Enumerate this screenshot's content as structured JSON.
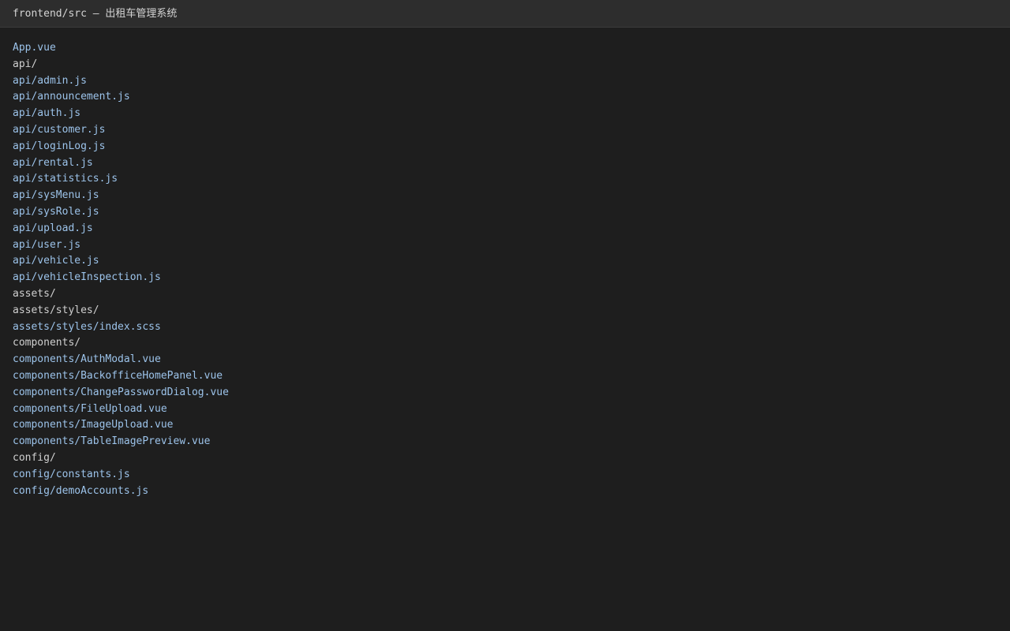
{
  "window": {
    "title": "frontend/src — 出租车管理系统"
  },
  "colors": {
    "background": "#1e1e1e",
    "titlebar": "#2d2d2d",
    "file_text": "#9cc3ea",
    "dir_text": "#d0d0d0"
  },
  "entries": [
    {
      "path": "App.vue",
      "type": "file"
    },
    {
      "path": "api/",
      "type": "dir"
    },
    {
      "path": "api/admin.js",
      "type": "file"
    },
    {
      "path": "api/announcement.js",
      "type": "file"
    },
    {
      "path": "api/auth.js",
      "type": "file"
    },
    {
      "path": "api/customer.js",
      "type": "file"
    },
    {
      "path": "api/loginLog.js",
      "type": "file"
    },
    {
      "path": "api/rental.js",
      "type": "file"
    },
    {
      "path": "api/statistics.js",
      "type": "file"
    },
    {
      "path": "api/sysMenu.js",
      "type": "file"
    },
    {
      "path": "api/sysRole.js",
      "type": "file"
    },
    {
      "path": "api/upload.js",
      "type": "file"
    },
    {
      "path": "api/user.js",
      "type": "file"
    },
    {
      "path": "api/vehicle.js",
      "type": "file"
    },
    {
      "path": "api/vehicleInspection.js",
      "type": "file"
    },
    {
      "path": "assets/",
      "type": "dir"
    },
    {
      "path": "assets/styles/",
      "type": "dir"
    },
    {
      "path": "assets/styles/index.scss",
      "type": "file"
    },
    {
      "path": "components/",
      "type": "dir"
    },
    {
      "path": "components/AuthModal.vue",
      "type": "file"
    },
    {
      "path": "components/BackofficeHomePanel.vue",
      "type": "file"
    },
    {
      "path": "components/ChangePasswordDialog.vue",
      "type": "file"
    },
    {
      "path": "components/FileUpload.vue",
      "type": "file"
    },
    {
      "path": "components/ImageUpload.vue",
      "type": "file"
    },
    {
      "path": "components/TableImagePreview.vue",
      "type": "file"
    },
    {
      "path": "config/",
      "type": "dir"
    },
    {
      "path": "config/constants.js",
      "type": "file"
    },
    {
      "path": "config/demoAccounts.js",
      "type": "file"
    }
  ]
}
